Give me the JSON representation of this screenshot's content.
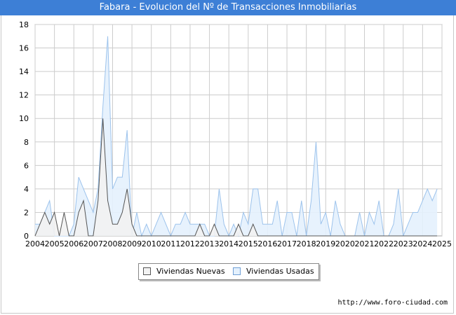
{
  "header": {
    "title": "Fabara - Evolucion del Nº de Transacciones Inmobiliarias"
  },
  "footer": {
    "source": "http://www.foro-ciudad.com"
  },
  "colors": {
    "title_bar": "#3d7fd6",
    "nuevas_line": "#555555",
    "nuevas_fill": "#f2f2f2",
    "usadas_line": "#9dc3ec",
    "usadas_fill": "#e4f1fd",
    "grid": "#cccccc"
  },
  "chart_data": {
    "type": "area",
    "title": "Fabara - Evolucion del Nº de Transacciones Inmobiliarias",
    "xlabel": "",
    "ylabel": "",
    "x_ticks": [
      "2004",
      "2005",
      "2006",
      "2007",
      "2008",
      "2009",
      "2010",
      "2011",
      "2012",
      "2013",
      "2014",
      "2015",
      "2016",
      "2017",
      "2018",
      "2019",
      "2020",
      "2021",
      "2022",
      "2023",
      "2024",
      "2025"
    ],
    "y_ticks": [
      "0",
      "2",
      "4",
      "6",
      "8",
      "10",
      "12",
      "14",
      "16",
      "18"
    ],
    "ylim": [
      0,
      18
    ],
    "xlim": [
      2004,
      2025
    ],
    "grid": true,
    "legend_position": "bottom",
    "x": [
      2004.0,
      2004.25,
      2004.5,
      2004.75,
      2005.0,
      2005.25,
      2005.5,
      2005.75,
      2006.0,
      2006.25,
      2006.5,
      2006.75,
      2007.0,
      2007.25,
      2007.5,
      2007.75,
      2008.0,
      2008.25,
      2008.5,
      2008.75,
      2009.0,
      2009.25,
      2009.5,
      2009.75,
      2010.0,
      2010.25,
      2010.5,
      2010.75,
      2011.0,
      2011.25,
      2011.5,
      2011.75,
      2012.0,
      2012.25,
      2012.5,
      2012.75,
      2013.0,
      2013.25,
      2013.5,
      2013.75,
      2014.0,
      2014.25,
      2014.5,
      2014.75,
      2015.0,
      2015.25,
      2015.5,
      2015.75,
      2016.0,
      2016.25,
      2016.5,
      2016.75,
      2017.0,
      2017.25,
      2017.5,
      2017.75,
      2018.0,
      2018.25,
      2018.5,
      2018.75,
      2019.0,
      2019.25,
      2019.5,
      2019.75,
      2020.0,
      2020.25,
      2020.5,
      2020.75,
      2021.0,
      2021.25,
      2021.5,
      2021.75,
      2022.0,
      2022.25,
      2022.5,
      2022.75,
      2023.0,
      2023.25,
      2023.5,
      2023.75,
      2024.0,
      2024.25,
      2024.5,
      2024.75
    ],
    "series": [
      {
        "name": "Viviendas Nuevas",
        "values": [
          0,
          1,
          2,
          1,
          2,
          0,
          2,
          0,
          0,
          2,
          3,
          0,
          0,
          3,
          10,
          3,
          1,
          1,
          2,
          4,
          1,
          0,
          0,
          0,
          0,
          0,
          0,
          0,
          0,
          0,
          0,
          0,
          0,
          0,
          1,
          0,
          0,
          1,
          0,
          0,
          0,
          0,
          1,
          0,
          0,
          1,
          0,
          0,
          0,
          0,
          0,
          0,
          0,
          0,
          0,
          0,
          0,
          0,
          0,
          0,
          0,
          0,
          0,
          0,
          0,
          0,
          0,
          0,
          0,
          0,
          0,
          0,
          0,
          0,
          0,
          0,
          0,
          0,
          0,
          0,
          0,
          0,
          0,
          0
        ]
      },
      {
        "name": "Viviendas Usadas",
        "values": [
          1,
          1,
          2,
          3,
          0,
          0,
          0,
          0,
          1,
          5,
          4,
          3,
          2,
          4,
          11,
          17,
          4,
          5,
          5,
          9,
          0,
          2,
          0,
          1,
          0,
          1,
          2,
          1,
          0,
          1,
          1,
          2,
          1,
          1,
          1,
          1,
          0,
          0,
          4,
          1,
          0,
          1,
          0,
          2,
          1,
          4,
          4,
          1,
          1,
          1,
          3,
          0,
          2,
          2,
          0,
          3,
          0,
          3,
          8,
          1,
          2,
          0,
          3,
          1,
          0,
          0,
          0,
          2,
          0,
          2,
          1,
          3,
          0,
          0,
          1,
          4,
          0,
          1,
          2,
          2,
          3,
          4,
          3,
          4
        ]
      }
    ]
  },
  "legend": {
    "items": [
      {
        "label": "Viviendas Nuevas"
      },
      {
        "label": "Viviendas Usadas"
      }
    ]
  }
}
